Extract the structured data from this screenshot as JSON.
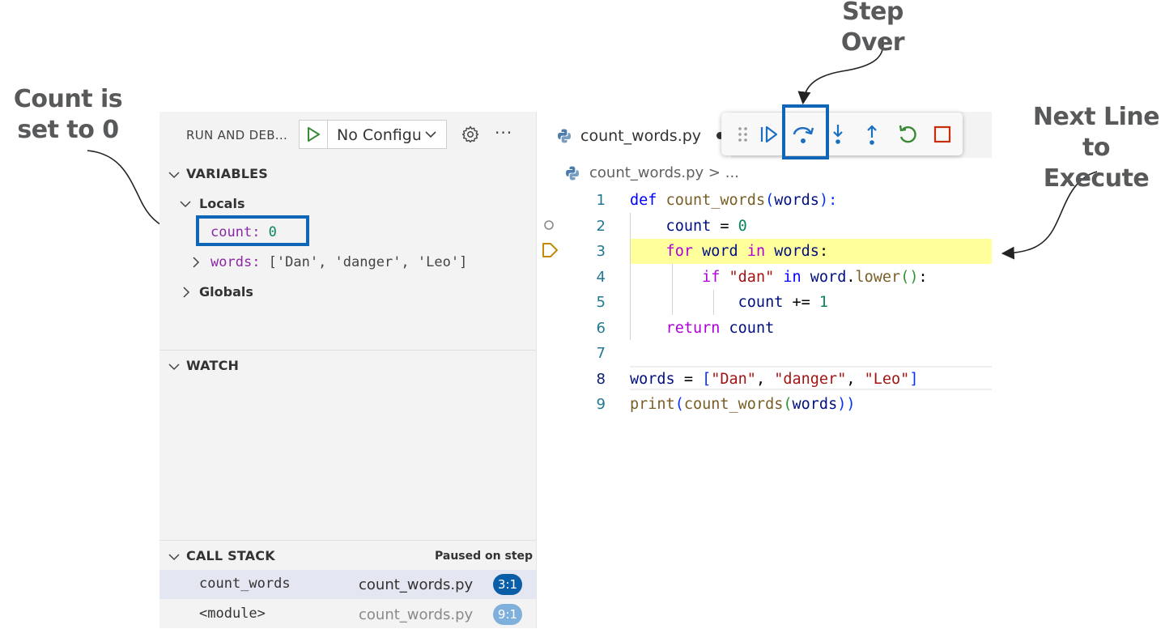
{
  "annotations": {
    "count_note": "Count is set to 0",
    "step_over_note": "Step Over",
    "next_line_note": "Next Line to Execute"
  },
  "sidebar": {
    "title": "RUN AND DEB...",
    "config_value": "No Configu",
    "variables": {
      "label": "VARIABLES",
      "locals_label": "Locals",
      "count_name": "count",
      "count_sep": ": ",
      "count_value": "0",
      "words_name": "words",
      "words_sep": ": ",
      "words_value": "['Dan', 'danger', 'Leo']",
      "globals_label": "Globals"
    },
    "watch": {
      "label": "WATCH"
    },
    "call_stack": {
      "label": "CALL STACK",
      "status": "Paused on step",
      "frames": [
        {
          "name": "count_words",
          "file": "count_words.py",
          "position": "3:1",
          "badge_color": "#0a5ea8",
          "file_color": "#333333"
        },
        {
          "name": "<module>",
          "file": "count_words.py",
          "position": "9:1",
          "badge_color": "#7fb0dc",
          "file_color": "#8a8a8a"
        }
      ]
    }
  },
  "editor": {
    "tab_label": "count_words.py",
    "breadcrumb": "count_words.py > ...",
    "line_numbers": [
      "1",
      "2",
      "3",
      "4",
      "5",
      "6",
      "7",
      "8",
      "9"
    ],
    "current_line": "3",
    "lines": [
      [
        [
          "def ",
          "k-blue"
        ],
        [
          "count_words",
          "k-fn"
        ],
        [
          "(",
          "k-br1"
        ],
        [
          "words",
          "k-var"
        ],
        [
          "):",
          "k-br1"
        ]
      ],
      [
        [
          "    count ",
          "k-var"
        ],
        [
          "= ",
          "k-op"
        ],
        [
          "0",
          "k-num"
        ]
      ],
      [
        [
          "    for ",
          "k-purple"
        ],
        [
          "word ",
          "k-var"
        ],
        [
          "in ",
          "k-purple"
        ],
        [
          "words",
          "k-var"
        ],
        [
          ":",
          "k-op"
        ]
      ],
      [
        [
          "        if ",
          "k-purple"
        ],
        [
          "\"dan\" ",
          "k-str"
        ],
        [
          "in ",
          "k-blue"
        ],
        [
          "word",
          "k-var"
        ],
        [
          ".",
          "k-op"
        ],
        [
          "lower",
          "k-fn"
        ],
        [
          "()",
          "k-br2"
        ],
        [
          ":",
          "k-op"
        ]
      ],
      [
        [
          "            count ",
          "k-var"
        ],
        [
          "+= ",
          "k-op"
        ],
        [
          "1",
          "k-num"
        ]
      ],
      [
        [
          "    return ",
          "k-purple"
        ],
        [
          "count",
          "k-var"
        ]
      ],
      [],
      [
        [
          "words ",
          "k-var"
        ],
        [
          "= ",
          "k-op"
        ],
        [
          "[",
          "k-br1"
        ],
        [
          "\"Dan\"",
          "k-str"
        ],
        [
          ", ",
          "k-op"
        ],
        [
          "\"danger\"",
          "k-str"
        ],
        [
          ", ",
          "k-op"
        ],
        [
          "\"Leo\"",
          "k-str"
        ],
        [
          "]",
          "k-br1"
        ]
      ],
      [
        [
          "print",
          "k-fn"
        ],
        [
          "(",
          "k-br1"
        ],
        [
          "count_words",
          "k-fn"
        ],
        [
          "(",
          "k-br2"
        ],
        [
          "words",
          "k-var"
        ],
        [
          "))",
          "k-br1"
        ]
      ]
    ]
  },
  "debug_toolbar": {
    "buttons": [
      "drag-handle",
      "continue",
      "step-over",
      "step-into",
      "step-out",
      "restart",
      "stop"
    ]
  },
  "colors": {
    "highlight_box": "#0f66b7",
    "current_line_bg": "#ffff9c",
    "annotation_text": "#58595b"
  }
}
